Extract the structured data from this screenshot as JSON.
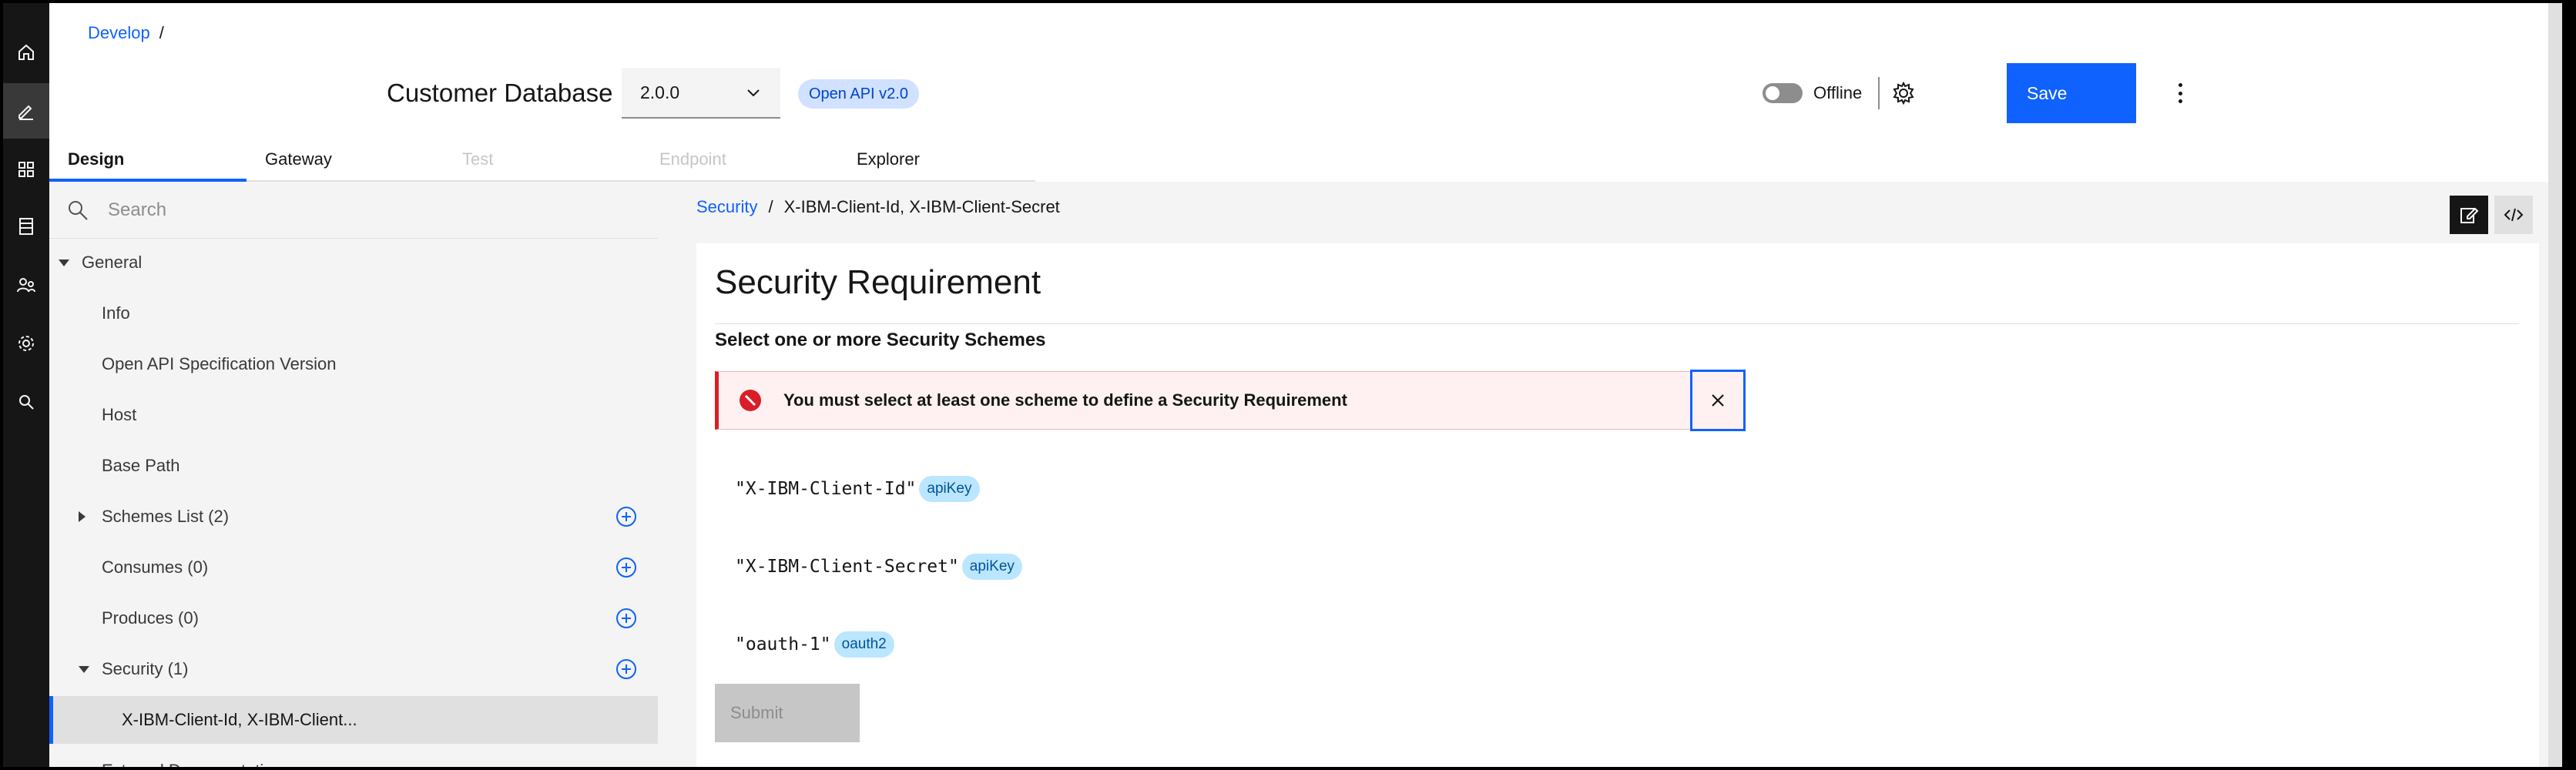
{
  "rail": {
    "items": [
      "home-icon",
      "edit-icon",
      "apps-icon",
      "catalog-icon",
      "users-icon",
      "settings-icon",
      "search-icon"
    ],
    "active": "edit-icon"
  },
  "header": {
    "breadcrumb_link": "Develop",
    "breadcrumb_sep": "/",
    "api_title": "Customer Database",
    "version": "2.0.0",
    "spec_tag": "Open API v2.0",
    "offline_label": "Offline",
    "save_label": "Save"
  },
  "tabs": [
    {
      "label": "Design",
      "state": "active"
    },
    {
      "label": "Gateway",
      "state": "normal"
    },
    {
      "label": "Test",
      "state": "disabled"
    },
    {
      "label": "Endpoint",
      "state": "disabled"
    },
    {
      "label": "Explorer",
      "state": "normal"
    }
  ],
  "nav": {
    "search_placeholder": "Search",
    "items": [
      {
        "label": "General",
        "level": 0,
        "caret": "down",
        "add": false,
        "selected": false
      },
      {
        "label": "Info",
        "level": 1,
        "caret": "",
        "add": false,
        "selected": false
      },
      {
        "label": "Open API Specification Version",
        "level": 1,
        "caret": "",
        "add": false,
        "selected": false
      },
      {
        "label": "Host",
        "level": 1,
        "caret": "",
        "add": false,
        "selected": false
      },
      {
        "label": "Base Path",
        "level": 1,
        "caret": "",
        "add": false,
        "selected": false
      },
      {
        "label": "Schemes List (2)",
        "level": 1,
        "caret": "right",
        "add": true,
        "selected": false
      },
      {
        "label": "Consumes (0)",
        "level": 1,
        "caret": "",
        "add": true,
        "selected": false
      },
      {
        "label": "Produces (0)",
        "level": 1,
        "caret": "",
        "add": true,
        "selected": false
      },
      {
        "label": "Security (1)",
        "level": 1,
        "caret": "down",
        "add": true,
        "selected": false
      },
      {
        "label": "X-IBM-Client-Id, X-IBM-Client...",
        "level": 2,
        "caret": "",
        "add": false,
        "selected": true
      },
      {
        "label": "External Documentation",
        "level": 1,
        "caret": "",
        "add": false,
        "selected": false
      }
    ]
  },
  "main": {
    "crumb_link": "Security",
    "crumb_sep": "/",
    "crumb_current": "X-IBM-Client-Id, X-IBM-Client-Secret",
    "title": "Security Requirement",
    "subheading": "Select one or more Security Schemes",
    "error_text": "You must select at least one scheme to define a Security Requirement",
    "schemes": [
      {
        "name": "\"X-IBM-Client-Id\"",
        "type": "apiKey"
      },
      {
        "name": "\"X-IBM-Client-Secret\"",
        "type": "apiKey"
      },
      {
        "name": "\"oauth-1\"",
        "type": "oauth2"
      }
    ],
    "submit_label": "Submit"
  },
  "colors": {
    "accent": "#0f62fe",
    "rail_bg": "#161616",
    "error": "#da1e28",
    "error_bg": "#fff1f1",
    "tag_bg": "#bae6ff"
  }
}
